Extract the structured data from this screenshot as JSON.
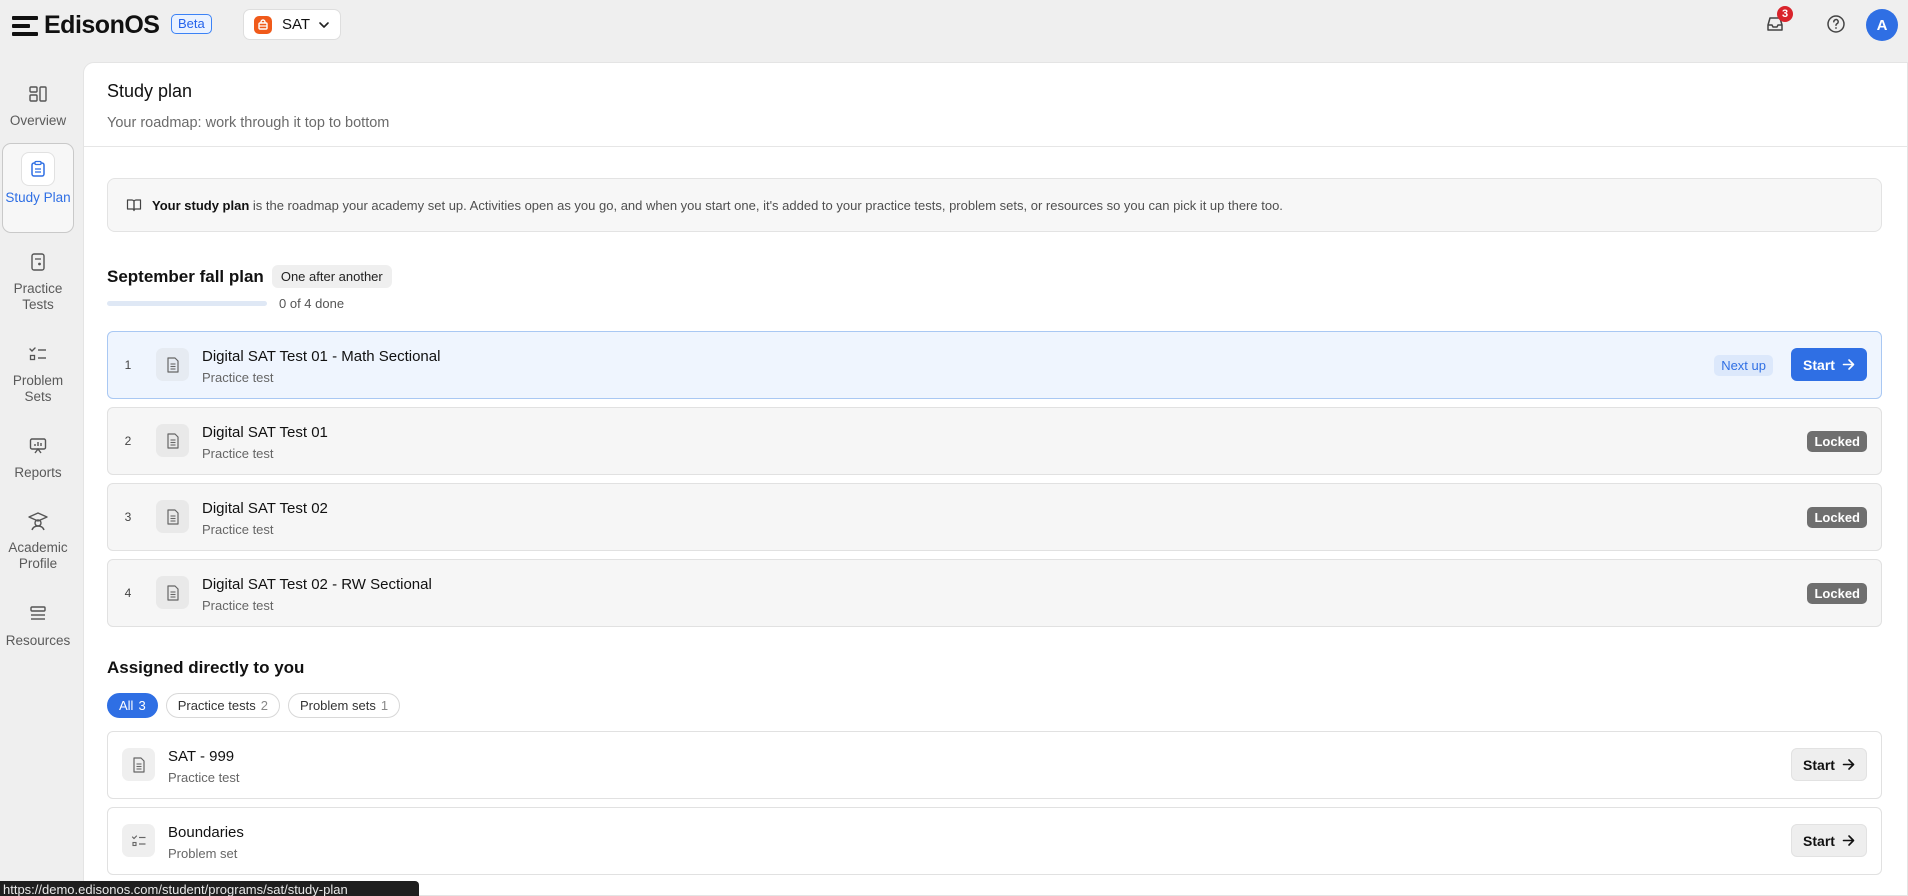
{
  "app": {
    "name": "EdisonOS",
    "beta_label": "Beta",
    "program": "SAT",
    "notifications_count": "3",
    "avatar_initial": "A"
  },
  "sidebar": {
    "items": [
      {
        "label": "Overview",
        "icon": "overview-icon"
      },
      {
        "label": "Study Plan",
        "icon": "clipboard-icon",
        "active": true
      },
      {
        "label": "Practice Tests",
        "icon": "practice-test-icon"
      },
      {
        "label": "Problem Sets",
        "icon": "checklist-icon"
      },
      {
        "label": "Reports",
        "icon": "presentation-chart-icon"
      },
      {
        "label": "Academic Profile",
        "icon": "graduation-icon"
      },
      {
        "label": "Resources",
        "icon": "stack-icon"
      }
    ]
  },
  "page": {
    "title": "Study plan",
    "subtitle": "Your roadmap: work through it top to bottom"
  },
  "info": {
    "bold": "Your study plan",
    "text": " is the roadmap your academy set up. Activities open as you go, and when you start one, it's added to your practice tests, problem sets, or resources so you can pick it up there too."
  },
  "plan": {
    "title": "September fall plan",
    "mode": "One after another",
    "progress_text": "0 of 4 done",
    "progress_fraction": 0,
    "items": [
      {
        "num": "1",
        "title": "Digital SAT Test 01 - Math Sectional",
        "type": "Practice test",
        "status": "Next up",
        "action": "Start"
      },
      {
        "num": "2",
        "title": "Digital SAT Test 01",
        "type": "Practice test",
        "status": "Locked"
      },
      {
        "num": "3",
        "title": "Digital SAT Test 02",
        "type": "Practice test",
        "status": "Locked"
      },
      {
        "num": "4",
        "title": "Digital SAT Test 02 - RW Sectional",
        "type": "Practice test",
        "status": "Locked"
      }
    ]
  },
  "assigned": {
    "title": "Assigned directly to you",
    "filters": [
      {
        "label": "All",
        "count": "3",
        "active": true
      },
      {
        "label": "Practice tests",
        "count": "2"
      },
      {
        "label": "Problem sets",
        "count": "1"
      }
    ],
    "items": [
      {
        "title": "SAT - 999",
        "type": "Practice test",
        "action": "Start"
      },
      {
        "title": "Boundaries",
        "type": "Problem set",
        "action": "Start"
      }
    ]
  },
  "status_bar": {
    "url": "https://demo.edisonos.com/student/programs/sat/study-plan"
  },
  "colors": {
    "accent": "#2f6fe4",
    "program_badge": "#f05a1a",
    "notification": "#d9232b",
    "locked": "#6f6f6f"
  }
}
